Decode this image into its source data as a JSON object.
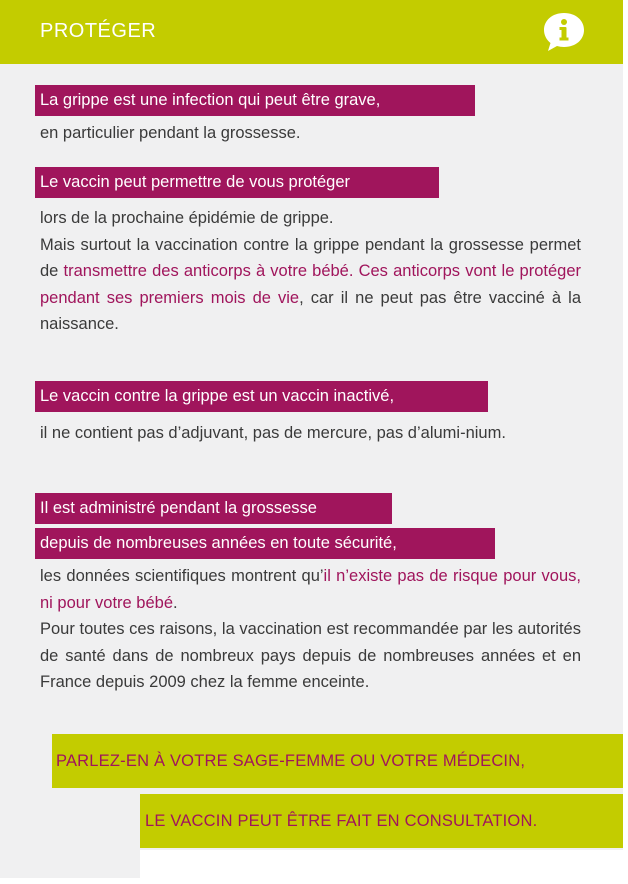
{
  "header": {
    "title": "PROTÉGER",
    "icon": "info-speech-bubble-icon",
    "icon_glyph": "i"
  },
  "colors": {
    "accent_green": "#c3cc00",
    "accent_magenta": "#a0155c",
    "background": "#f0f0f1",
    "text": "#3a3a3a"
  },
  "sections": [
    {
      "highlights": [
        "La grippe est une infection qui peut être grave,"
      ],
      "paragraph": {
        "text_1": "en particulier pendant la grossesse."
      }
    },
    {
      "highlights": [
        "Le vaccin peut permettre de vous protéger"
      ],
      "paragraph": {
        "text_1": "lors de la prochaine épidémie de grippe.",
        "text_2": "Mais surtout la vaccination contre la grippe pendant la grossesse permet de ",
        "emphasis_1": "transmettre des anticorps à votre bébé. Ces anticorps vont le protéger pendant ses premiers mois de vie",
        "text_3": ", car il ne peut pas être vacciné à la naissance."
      }
    },
    {
      "highlights": [
        "Le vaccin contre la grippe est un vaccin inactivé,"
      ],
      "paragraph": {
        "text_1": "il ne contient pas d’adjuvant, pas de mercure, pas d’alumi-nium."
      }
    },
    {
      "highlights": [
        "Il est administré pendant la grossesse",
        "depuis de nombreuses années en toute sécurité,"
      ],
      "paragraph": {
        "text_1": "les données scientifiques montrent qu’",
        "emphasis_1": "il n’existe pas de risque pour vous, ni pour votre bébé",
        "text_2": ".",
        "text_3": "Pour toutes ces raisons, la vaccination est recommandée par les autorités de santé dans de nombreux pays depuis de nombreuses années et en France depuis 2009 chez la femme enceinte."
      }
    }
  ],
  "callouts": [
    "PARLEZ-EN À VOTRE SAGE-FEMME OU VOTRE MÉDECIN,",
    "LE VACCIN PEUT ÊTRE FAIT EN CONSULTATION."
  ]
}
